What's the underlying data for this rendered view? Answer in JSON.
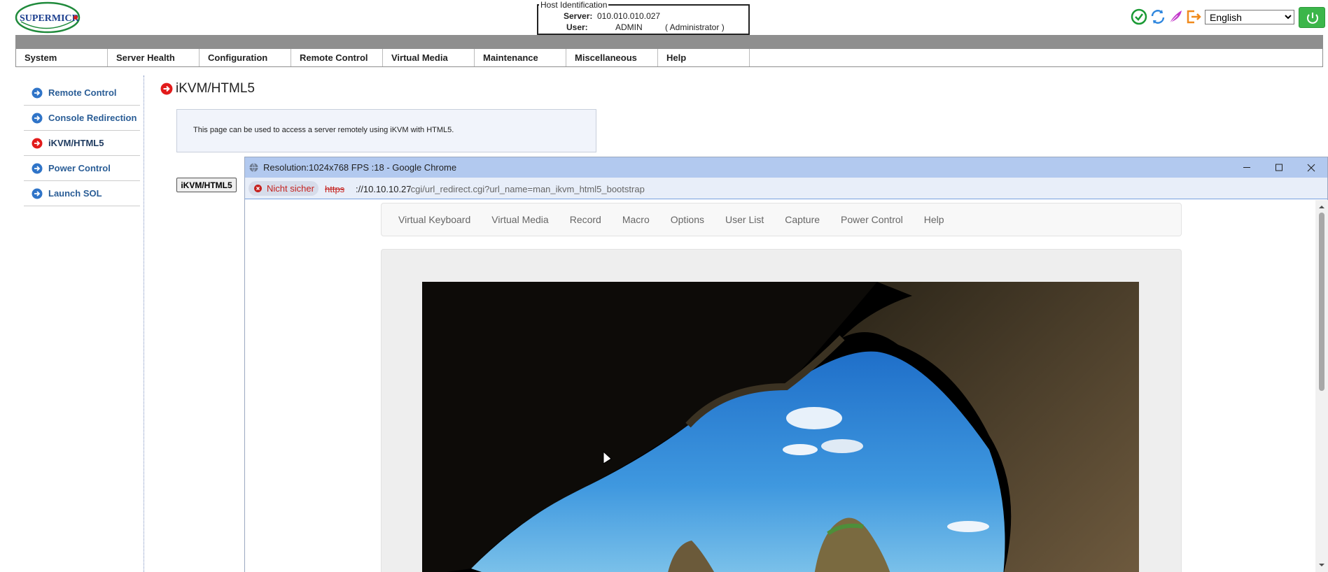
{
  "header": {
    "logo_text": "SUPERMICR",
    "host_id": {
      "legend": "Host Identification",
      "server_label": "Server:",
      "server_value": "010.010.010.027",
      "user_label": "User:",
      "user_value": "ADMIN",
      "role": "( Administrator )"
    },
    "icons": [
      "status-ok-icon",
      "refresh-icon",
      "feather-icon",
      "logout-icon",
      "power-icon"
    ],
    "language": "English"
  },
  "nav": {
    "items": [
      "System",
      "Server Health",
      "Configuration",
      "Remote Control",
      "Virtual Media",
      "Maintenance",
      "Miscellaneous",
      "Help"
    ]
  },
  "sidebar": {
    "items": [
      {
        "label": "Remote Control",
        "active": false
      },
      {
        "label": "Console Redirection",
        "active": false
      },
      {
        "label": "iKVM/HTML5",
        "active": true
      },
      {
        "label": "Power Control",
        "active": false
      },
      {
        "label": "Launch SOL",
        "active": false
      }
    ]
  },
  "main": {
    "title": "iKVM/HTML5",
    "info": "This page can be used to access a server remotely using iKVM with HTML5.",
    "button_label": "iKVM/HTML5"
  },
  "popup": {
    "title": "Resolution:1024x768 FPS :18 - Google Chrome",
    "security_label": "Nicht sicher",
    "url_protocol": "https",
    "url_host": "://10.10.10.27",
    "url_path": "/cgi/url_redirect.cgi?url_name=man_ikvm_html5_bootstrap",
    "menu": [
      "Virtual Keyboard",
      "Virtual Media",
      "Record",
      "Macro",
      "Options",
      "User List",
      "Capture",
      "Power Control",
      "Help"
    ]
  },
  "colors": {
    "accent_link": "#2a5d96",
    "active_icon": "#e21b1b",
    "link_icon": "#2f74c8",
    "popup_titlebar": "#b2c9ef",
    "power_button": "#3cb64a"
  }
}
